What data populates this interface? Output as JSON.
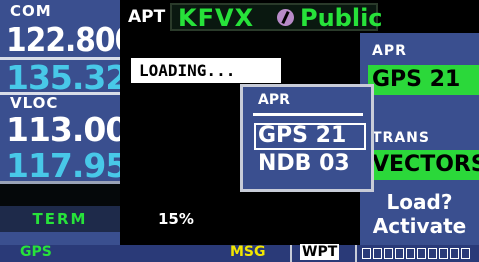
{
  "com": {
    "label": "COM",
    "active": "122.800",
    "standby": "135.325"
  },
  "vloc": {
    "label": "VLOC",
    "active": "113.00",
    "standby": "117.95"
  },
  "term": "TERM",
  "gps": "GPS",
  "apt": {
    "label": "APT",
    "id": "KFVX",
    "type": "Public"
  },
  "loading": "LOADING...",
  "progress": "15%",
  "apr": {
    "label": "APR",
    "value": "GPS 21"
  },
  "trans": {
    "label": "TRANS",
    "value": "VECTORS"
  },
  "load_prompt": {
    "line1": "Load?",
    "line2": "Activate"
  },
  "popup": {
    "title": "APR",
    "items": [
      "GPS 21",
      "NDB 03"
    ]
  },
  "status": {
    "msg": "MSG",
    "wpt": "WPT"
  },
  "colors": {
    "green": "#27e23a",
    "cyan": "#48c8e8",
    "blue": "#3a4f8f",
    "yellow": "#f2e600"
  }
}
